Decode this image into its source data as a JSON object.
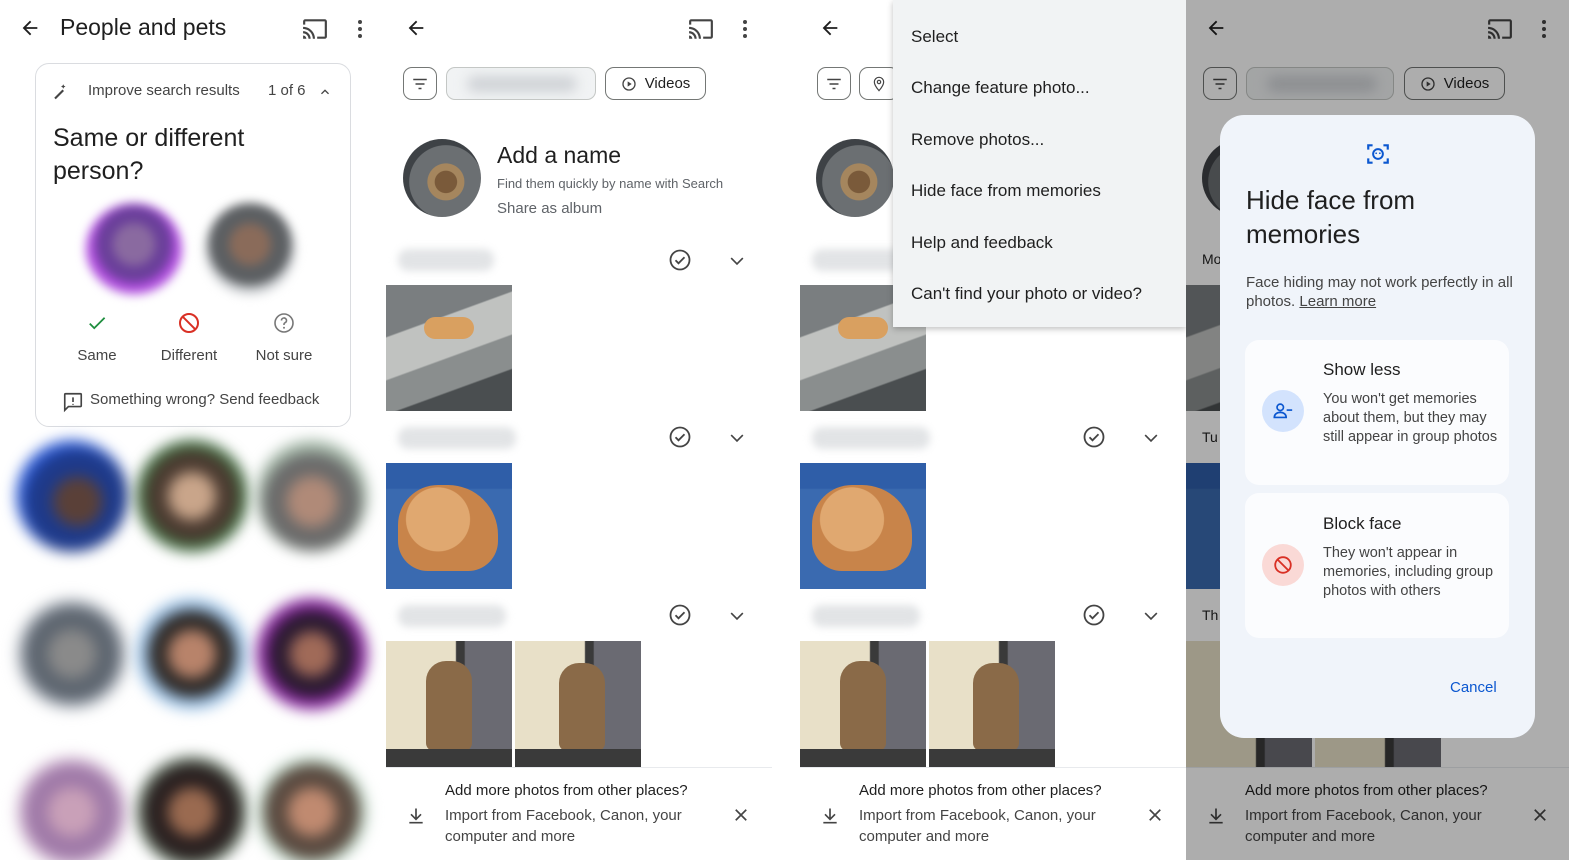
{
  "panel1": {
    "title": "People and pets",
    "improve": {
      "heading": "Improve search results",
      "count": "1 of 6",
      "question": "Same or different person?",
      "choices": {
        "same": "Same",
        "different": "Different",
        "not_sure": "Not sure"
      },
      "feedback": "Something wrong? Send feedback"
    }
  },
  "panel2": {
    "videos_chip": "Videos",
    "add_name": "Add a name",
    "find_them": "Find them quickly by name with Search",
    "share_album": "Share as album",
    "bottom": {
      "title": "Add more photos from other places?",
      "subtitle": "Import from Facebook, Canon, your computer and more"
    }
  },
  "panel3": {
    "menu": [
      "Select",
      "Change feature photo...",
      "Remove photos...",
      "Hide face from memories",
      "Help and feedback",
      "Can't find your photo or video?"
    ],
    "bottom": {
      "title": "Add more photos from other places?",
      "subtitle": "Import from Facebook, Canon, your computer and more"
    }
  },
  "panel4": {
    "videos_chip": "Videos",
    "dialog": {
      "title": "Hide face from memories",
      "body": "Face hiding may not work perfectly in all photos.",
      "learn_more": "Learn more",
      "show_less": {
        "title": "Show less",
        "text": "You won't get memories about them, but they may still appear in group photos"
      },
      "block_face": {
        "title": "Block face",
        "text": "They won't appear in memories, including group photos with others"
      },
      "cancel": "Cancel"
    },
    "peek_labels": {
      "mo": "Mo",
      "tu": "Tu",
      "th": "Th"
    },
    "bottom": {
      "title": "Add more photos from other places?",
      "subtitle": "Import from Facebook, Canon, your computer and more"
    }
  },
  "colors": {
    "accent_blue": "#0b57d0",
    "same_green": "#1e8e3e",
    "different_red": "#d93025",
    "dialog_bg": "#f0f4fa"
  }
}
